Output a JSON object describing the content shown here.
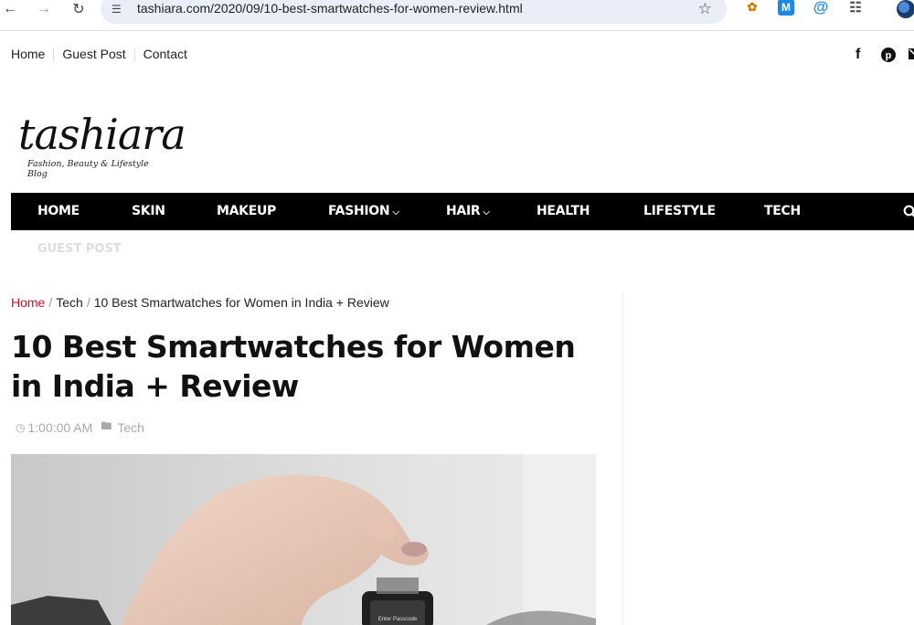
{
  "browser": {
    "url": "tashiara.com/2020/09/10-best-smartwatches-for-women-review.html",
    "icons": [
      "back-icon",
      "forward-icon",
      "reload-icon",
      "site-settings-icon",
      "bookmark-star-icon",
      "extensions-icon"
    ]
  },
  "toplinks": [
    {
      "label": "Home"
    },
    {
      "label": "Guest Post"
    },
    {
      "label": "Contact"
    }
  ],
  "social_icons": [
    "facebook-icon",
    "pinterest-icon",
    "mail-icon"
  ],
  "logo": {
    "word": "tashiara",
    "tagline": "Fashion, Beauty & Lifestyle Blog"
  },
  "mainnav": {
    "items": [
      {
        "label": "HOME"
      },
      {
        "label": "SKIN"
      },
      {
        "label": "MAKEUP"
      },
      {
        "label": "FASHION"
      },
      {
        "label": "HAIR"
      },
      {
        "label": "HEALTH"
      },
      {
        "label": "LIFESTYLE"
      },
      {
        "label": "TECH"
      }
    ],
    "overflow_item": "GUEST POST",
    "colors": {
      "bar": "#000000",
      "text": "#ffffff"
    }
  },
  "breadcrumb": {
    "home": "Home",
    "category": "Tech",
    "current": "10 Best Smartwatches for Women in India + Review",
    "home_color": "#c8102e"
  },
  "article": {
    "title": "10 Best Smartwatches for Women in India + Review",
    "time": "1:00:00 AM",
    "category": "Tech"
  },
  "watch_screen_text": "Enter Passcode"
}
